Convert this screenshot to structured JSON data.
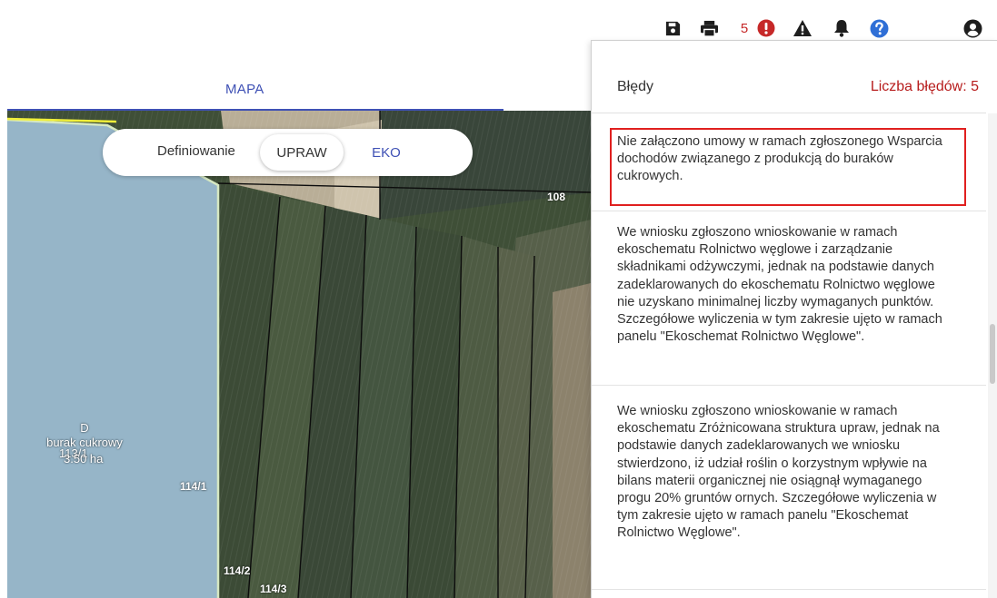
{
  "toolbar": {
    "error_count": "5",
    "icons": [
      "save-icon",
      "print-icon",
      "error-icon",
      "warning-icon",
      "bell-icon",
      "help-icon",
      "user-icon"
    ],
    "colors": {
      "error": "#c62828",
      "help": "#2f6fd6",
      "dark": "#1e1e1e"
    }
  },
  "tabs": {
    "map_label": "MAPA"
  },
  "switch": {
    "label": "Definiowanie",
    "upraw_label": "UPRAW",
    "eko_label": "EKO"
  },
  "map": {
    "parcels": [
      {
        "id": "108",
        "label": "108"
      },
      {
        "id": "114-1",
        "label": "114/1"
      },
      {
        "id": "114-2",
        "label": "114/2"
      },
      {
        "id": "114-3",
        "label": "114/3"
      }
    ],
    "field": {
      "letter": "D",
      "crop": "burak cukrowy",
      "parcel": "113/1",
      "area": "3.50 ha"
    }
  },
  "panel": {
    "title": "Błędy",
    "count_label": "Liczba błędów: 5",
    "errors": [
      "Nie załączono umowy w ramach zgłoszonego Wsparcia dochodów związanego z produkcją do buraków cukrowych.",
      "We wniosku zgłoszono wnioskowanie w ramach ekoschematu Rolnictwo węglowe i zarządzanie składnikami odżywczymi, jednak na podstawie danych zadeklarowanych do ekoschematu Rolnictwo węglowe nie uzyskano minimalnej liczby wymaganych punktów. Szczegółowe wyliczenia w tym zakresie ujęto w ramach panelu \"Ekoschemat Rolnictwo Węglowe\".",
      "We wniosku zgłoszono wnioskowanie w ramach ekoschematu Zróżnicowana struktura upraw, jednak na podstawie danych zadeklarowanych we wniosku stwierdzono, iż udział roślin o korzystnym wpływie na bilans materii organicznej nie osiągnął wymaganego progu 20% gruntów ornych. Szczegółowe wyliczenia w tym zakresie ujęto w ramach panelu \"Ekoschemat Rolnictwo Węglowe\"."
    ]
  }
}
